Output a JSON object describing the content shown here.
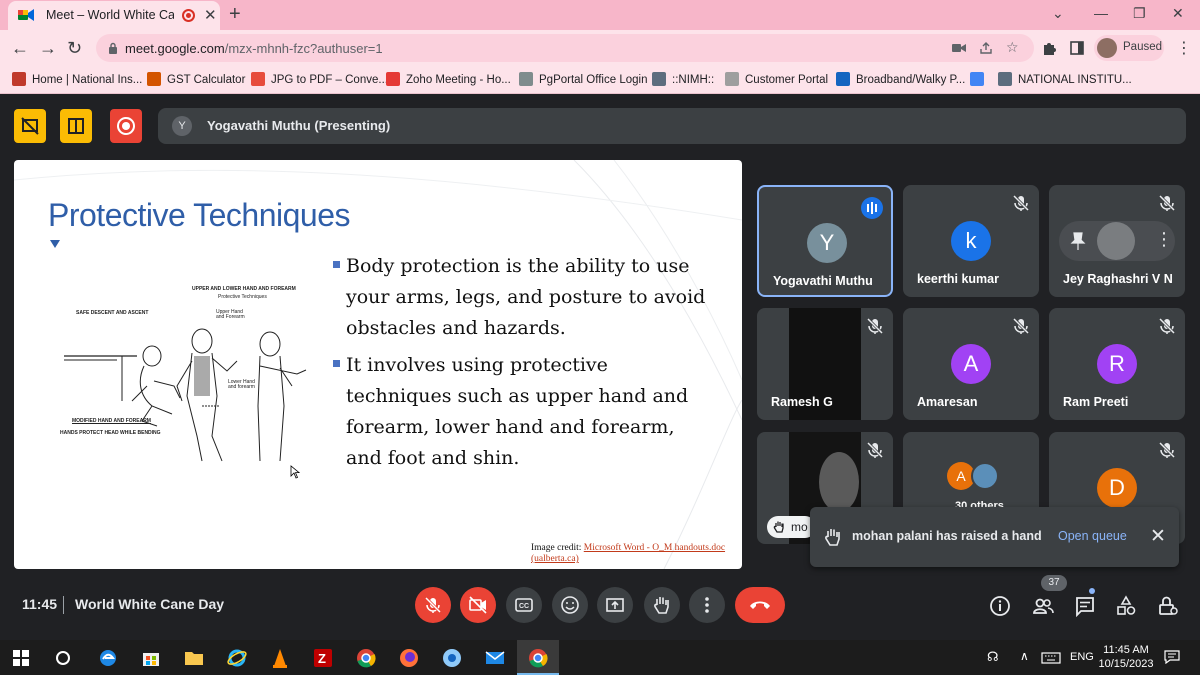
{
  "browser": {
    "tab_title": "Meet – World White Cane D",
    "url_host": "meet.google.com",
    "url_path": "/mzx-mhnh-fzc?authuser=1",
    "profile_label": "Paused",
    "bookmarks": [
      {
        "label": "Home | National Ins...",
        "color": "#c0392b"
      },
      {
        "label": "GST Calculator",
        "color": "#d35400"
      },
      {
        "label": "JPG to PDF – Conve...",
        "color": "#e74c3c"
      },
      {
        "label": "Zoho Meeting - Ho...",
        "color": "#e53935"
      },
      {
        "label": "PgPortal Office Login",
        "color": "#7f8c8d"
      },
      {
        "label": "::NIMH::",
        "color": "#5d6d7e"
      },
      {
        "label": "Customer Portal",
        "color": "#9e9e9e"
      },
      {
        "label": "Broadband/Walky P...",
        "color": "#1565c0"
      },
      {
        "label": "",
        "color": "#4285f4"
      },
      {
        "label": "NATIONAL INSTITU...",
        "color": "#5d6d7e"
      }
    ]
  },
  "meet": {
    "presenter_initial": "Y",
    "presenter_label": "Yogavathi Muthu (Presenting)",
    "slide": {
      "title": "Protective Techniques",
      "bullet1": "Body protection is the ability to use your arms, legs, and posture to avoid obstacles and hazards.",
      "bullet2": "It involves using protective techniques such as upper hand and forearm, lower hand and forearm, and foot and shin.",
      "credit_prefix": "Image credit: ",
      "credit_link": "Microsoft Word - O_M handouts.doc (ualberta.ca)",
      "illus_title": "UPPER AND LOWER HAND AND FOREARM",
      "illus_subtitle": "Protective Techniques",
      "illus_left": "SAFE DESCENT AND ASCENT",
      "illus_upper": "Upper Hand and Forearm",
      "illus_lower": "Lower Hand and forearm",
      "illus_modified": "MODIFIED HAND AND FOREARM",
      "illus_hands": "HANDS PROTECT HEAD WHILE BENDING"
    },
    "participants": [
      {
        "initial": "Y",
        "name": "Yogavathi Muthu",
        "color": "#78909c"
      },
      {
        "initial": "k",
        "name": "keerthi kumar",
        "color": "#1a73e8"
      },
      {
        "initial": "",
        "name": "Jey Raghashri V N",
        "color": ""
      },
      {
        "initial": "",
        "name": "Ramesh G",
        "color": ""
      },
      {
        "initial": "A",
        "name": "Amaresan",
        "color": "#a142f4"
      },
      {
        "initial": "R",
        "name": "Ram Preeti",
        "color": "#a142f4"
      },
      {
        "initial": "",
        "name": "mo",
        "color": ""
      },
      {
        "initial": "A",
        "name": "30 others",
        "color": "#e8710a"
      },
      {
        "initial": "D",
        "name": "",
        "color": "#e8710a"
      }
    ],
    "toast": {
      "message": "mohan palani has raised a hand",
      "action": "Open queue"
    },
    "time": "11:45",
    "meeting_name": "World White Cane Day",
    "people_count": "37"
  },
  "taskbar": {
    "lang": "ENG",
    "time": "11:45 AM",
    "date": "10/15/2023"
  }
}
